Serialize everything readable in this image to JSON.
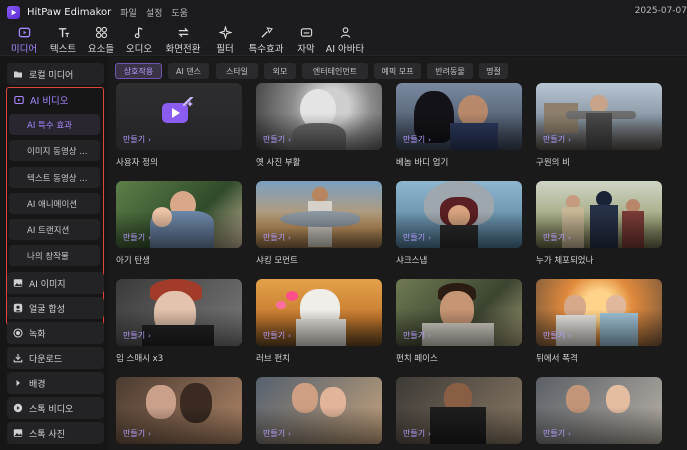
{
  "app": {
    "title": "HitPaw Edimakor",
    "menus": [
      "파일",
      "설정",
      "도움"
    ],
    "date": "2025-07-07"
  },
  "toolbar": [
    {
      "label": "미디어",
      "icon": "media-icon",
      "active": true
    },
    {
      "label": "텍스트",
      "icon": "text-icon"
    },
    {
      "label": "요소들",
      "icon": "elements-icon"
    },
    {
      "label": "오디오",
      "icon": "audio-icon"
    },
    {
      "label": "화면전환",
      "icon": "transition-icon"
    },
    {
      "label": "필터",
      "icon": "filter-icon"
    },
    {
      "label": "특수효과",
      "icon": "effects-icon"
    },
    {
      "label": "자막",
      "icon": "subtitle-icon"
    },
    {
      "label": "AI 아바타",
      "icon": "avatar-icon"
    }
  ],
  "sidebar": {
    "local_media": "로컬 미디어",
    "ai_video": {
      "label": "AI 비디오",
      "items": [
        "AI 특수 효과",
        "이미지 동영상 ...",
        "텍스트 동영상 ...",
        "AI 애니메이션",
        "AI 트랜지션",
        "나의 창작물"
      ],
      "active_index": 0
    },
    "items": [
      {
        "label": "AI 이미지",
        "icon": "image-icon"
      },
      {
        "label": "얼굴 합성",
        "icon": "face-swap-icon"
      },
      {
        "label": "녹화",
        "icon": "record-icon"
      },
      {
        "label": "다운로드",
        "icon": "download-icon"
      },
      {
        "label": "배경",
        "icon": "play-triangle-icon"
      },
      {
        "label": "스톡 비디오",
        "icon": "stock-video-icon"
      },
      {
        "label": "스톡 사진",
        "icon": "stock-photo-icon"
      }
    ]
  },
  "categories": [
    "상호작용",
    "AI 댄스",
    "스타일",
    "외모",
    "엔터테인먼트",
    "예픽 모프",
    "반려동물",
    "명절"
  ],
  "active_category": 0,
  "make_label": "만들기",
  "cards": [
    {
      "caption": "사용자 정의"
    },
    {
      "caption": "옛 사진 부활"
    },
    {
      "caption": "베놈 바디 업기"
    },
    {
      "caption": "구원의 비"
    },
    {
      "caption": "아기 탄생"
    },
    {
      "caption": "샤킹 모먼트"
    },
    {
      "caption": "샤크스냅"
    },
    {
      "caption": "누가 체포되었나"
    },
    {
      "caption": "임 스매시 x3"
    },
    {
      "caption": "러브 펀치"
    },
    {
      "caption": "펀치 페이스"
    },
    {
      "caption": "뒤에서 폭격"
    },
    {
      "caption": ""
    },
    {
      "caption": ""
    },
    {
      "caption": ""
    },
    {
      "caption": ""
    }
  ],
  "colors": {
    "accent": "#a786ff",
    "highlight_border": "#e0443a",
    "background": "#161617",
    "panel": "#232325"
  }
}
